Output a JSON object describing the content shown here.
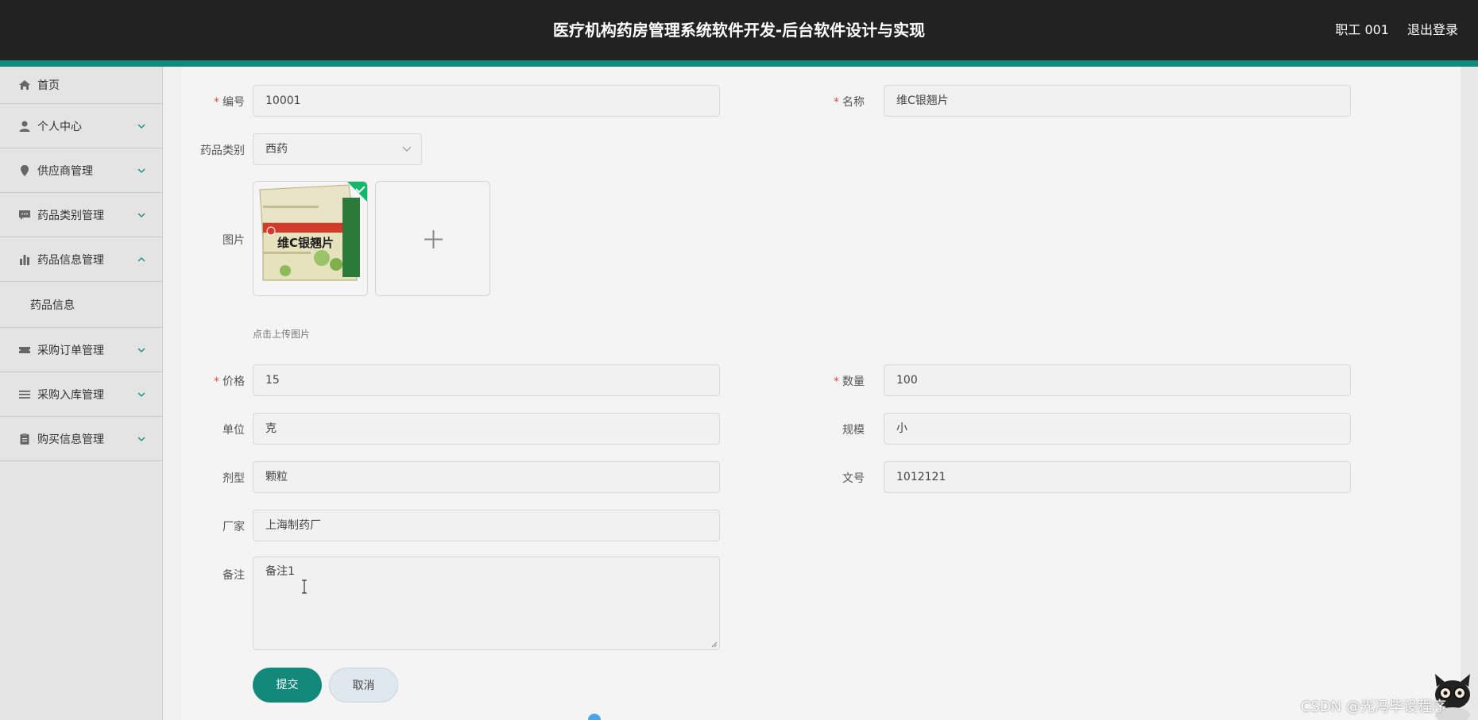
{
  "header": {
    "title": "医疗机构药房管理系统软件开发-后台软件设计与实现",
    "user": "职工 001",
    "logout": "退出登录"
  },
  "sidebar": {
    "items": [
      {
        "label": "首页",
        "icon": "home-icon"
      },
      {
        "label": "个人中心",
        "icon": "user-icon"
      },
      {
        "label": "供应商管理",
        "icon": "pin-icon"
      },
      {
        "label": "药品类别管理",
        "icon": "chat-icon"
      },
      {
        "label": "药品信息管理",
        "icon": "bar-chart-icon"
      },
      {
        "label": "采购订单管理",
        "icon": "ticket-icon"
      },
      {
        "label": "采购入库管理",
        "icon": "list-icon"
      },
      {
        "label": "购买信息管理",
        "icon": "clipboard-icon"
      }
    ],
    "subitem": "药品信息"
  },
  "form": {
    "code_label": "编号",
    "code_value": "10001",
    "name_label": "名称",
    "name_value": "维C银翘片",
    "category_label": "药品类别",
    "category_value": "西药",
    "image_label": "图片",
    "upload_hint": "点击上传图片",
    "price_label": "价格",
    "price_value": "15",
    "qty_label": "数量",
    "qty_value": "100",
    "unit_label": "单位",
    "unit_value": "克",
    "spec_label": "规模",
    "spec_value": "小",
    "dosage_label": "剂型",
    "dosage_value": "颗粒",
    "doc_label": "文号",
    "doc_value": "1012121",
    "maker_label": "厂家",
    "maker_value": "上海制药厂",
    "remark_label": "备注",
    "remark_value": "备注1",
    "required_mark": "*",
    "submit": "提交",
    "cancel": "取消",
    "package_text": "维C银翘片"
  },
  "watermark": "CSDN @光冯毕设程序",
  "colors": {
    "accent": "#13897c",
    "header_bg": "#222222",
    "required": "#e34b4b"
  }
}
